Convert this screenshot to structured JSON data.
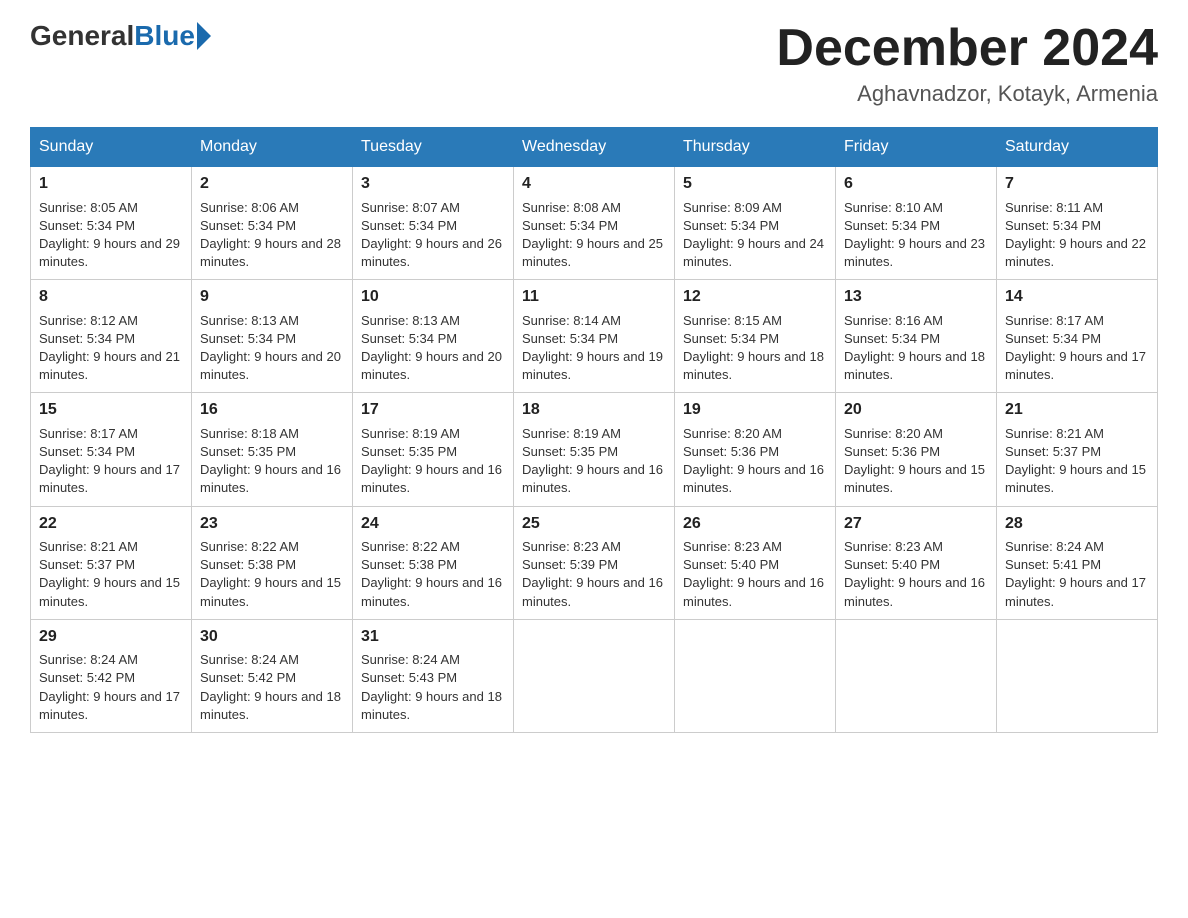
{
  "header": {
    "logo": {
      "general": "General",
      "blue": "Blue"
    },
    "title": "December 2024",
    "location": "Aghavnadzor, Kotayk, Armenia"
  },
  "days_of_week": [
    "Sunday",
    "Monday",
    "Tuesday",
    "Wednesday",
    "Thursday",
    "Friday",
    "Saturday"
  ],
  "weeks": [
    [
      {
        "day": "1",
        "sunrise": "8:05 AM",
        "sunset": "5:34 PM",
        "daylight": "9 hours and 29 minutes."
      },
      {
        "day": "2",
        "sunrise": "8:06 AM",
        "sunset": "5:34 PM",
        "daylight": "9 hours and 28 minutes."
      },
      {
        "day": "3",
        "sunrise": "8:07 AM",
        "sunset": "5:34 PM",
        "daylight": "9 hours and 26 minutes."
      },
      {
        "day": "4",
        "sunrise": "8:08 AM",
        "sunset": "5:34 PM",
        "daylight": "9 hours and 25 minutes."
      },
      {
        "day": "5",
        "sunrise": "8:09 AM",
        "sunset": "5:34 PM",
        "daylight": "9 hours and 24 minutes."
      },
      {
        "day": "6",
        "sunrise": "8:10 AM",
        "sunset": "5:34 PM",
        "daylight": "9 hours and 23 minutes."
      },
      {
        "day": "7",
        "sunrise": "8:11 AM",
        "sunset": "5:34 PM",
        "daylight": "9 hours and 22 minutes."
      }
    ],
    [
      {
        "day": "8",
        "sunrise": "8:12 AM",
        "sunset": "5:34 PM",
        "daylight": "9 hours and 21 minutes."
      },
      {
        "day": "9",
        "sunrise": "8:13 AM",
        "sunset": "5:34 PM",
        "daylight": "9 hours and 20 minutes."
      },
      {
        "day": "10",
        "sunrise": "8:13 AM",
        "sunset": "5:34 PM",
        "daylight": "9 hours and 20 minutes."
      },
      {
        "day": "11",
        "sunrise": "8:14 AM",
        "sunset": "5:34 PM",
        "daylight": "9 hours and 19 minutes."
      },
      {
        "day": "12",
        "sunrise": "8:15 AM",
        "sunset": "5:34 PM",
        "daylight": "9 hours and 18 minutes."
      },
      {
        "day": "13",
        "sunrise": "8:16 AM",
        "sunset": "5:34 PM",
        "daylight": "9 hours and 18 minutes."
      },
      {
        "day": "14",
        "sunrise": "8:17 AM",
        "sunset": "5:34 PM",
        "daylight": "9 hours and 17 minutes."
      }
    ],
    [
      {
        "day": "15",
        "sunrise": "8:17 AM",
        "sunset": "5:34 PM",
        "daylight": "9 hours and 17 minutes."
      },
      {
        "day": "16",
        "sunrise": "8:18 AM",
        "sunset": "5:35 PM",
        "daylight": "9 hours and 16 minutes."
      },
      {
        "day": "17",
        "sunrise": "8:19 AM",
        "sunset": "5:35 PM",
        "daylight": "9 hours and 16 minutes."
      },
      {
        "day": "18",
        "sunrise": "8:19 AM",
        "sunset": "5:35 PM",
        "daylight": "9 hours and 16 minutes."
      },
      {
        "day": "19",
        "sunrise": "8:20 AM",
        "sunset": "5:36 PM",
        "daylight": "9 hours and 16 minutes."
      },
      {
        "day": "20",
        "sunrise": "8:20 AM",
        "sunset": "5:36 PM",
        "daylight": "9 hours and 15 minutes."
      },
      {
        "day": "21",
        "sunrise": "8:21 AM",
        "sunset": "5:37 PM",
        "daylight": "9 hours and 15 minutes."
      }
    ],
    [
      {
        "day": "22",
        "sunrise": "8:21 AM",
        "sunset": "5:37 PM",
        "daylight": "9 hours and 15 minutes."
      },
      {
        "day": "23",
        "sunrise": "8:22 AM",
        "sunset": "5:38 PM",
        "daylight": "9 hours and 15 minutes."
      },
      {
        "day": "24",
        "sunrise": "8:22 AM",
        "sunset": "5:38 PM",
        "daylight": "9 hours and 16 minutes."
      },
      {
        "day": "25",
        "sunrise": "8:23 AM",
        "sunset": "5:39 PM",
        "daylight": "9 hours and 16 minutes."
      },
      {
        "day": "26",
        "sunrise": "8:23 AM",
        "sunset": "5:40 PM",
        "daylight": "9 hours and 16 minutes."
      },
      {
        "day": "27",
        "sunrise": "8:23 AM",
        "sunset": "5:40 PM",
        "daylight": "9 hours and 16 minutes."
      },
      {
        "day": "28",
        "sunrise": "8:24 AM",
        "sunset": "5:41 PM",
        "daylight": "9 hours and 17 minutes."
      }
    ],
    [
      {
        "day": "29",
        "sunrise": "8:24 AM",
        "sunset": "5:42 PM",
        "daylight": "9 hours and 17 minutes."
      },
      {
        "day": "30",
        "sunrise": "8:24 AM",
        "sunset": "5:42 PM",
        "daylight": "9 hours and 18 minutes."
      },
      {
        "day": "31",
        "sunrise": "8:24 AM",
        "sunset": "5:43 PM",
        "daylight": "9 hours and 18 minutes."
      },
      null,
      null,
      null,
      null
    ]
  ]
}
